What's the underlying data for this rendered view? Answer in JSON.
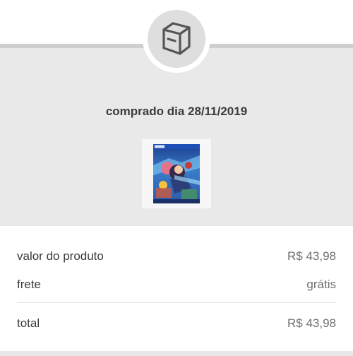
{
  "order": {
    "purchase_date_text": "comprado dia 28/11/2019",
    "status_icon": "package-box-icon",
    "product_image": "game-cover-thumbnail"
  },
  "summary": {
    "product_value_label": "valor do produto",
    "product_value": "R$ 43,98",
    "shipping_label": "frete",
    "shipping_value": "grátis",
    "total_label": "total",
    "total_value": "R$ 43,98"
  },
  "colors": {
    "header_background": "#e9e9e9",
    "icon_circle": "#dedede",
    "icon_stroke": "#555555"
  }
}
